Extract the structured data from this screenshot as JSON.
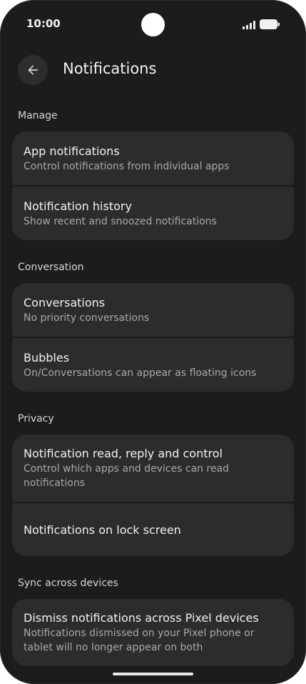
{
  "status_bar": {
    "time": "10:00",
    "icons": [
      "front-camera-icon",
      "signal-icon",
      "battery-icon"
    ]
  },
  "app_bar": {
    "back_icon": "arrow-back-icon",
    "title": "Notifications"
  },
  "sections": {
    "manage": {
      "header": "Manage",
      "items": [
        {
          "title": "App notifications",
          "summary": "Control notifications from individual apps"
        },
        {
          "title": "Notification history",
          "summary": "Show recent and snoozed notifications"
        }
      ]
    },
    "conversation": {
      "header": "Conversation",
      "items": [
        {
          "title": "Conversations",
          "summary": "No priority conversations"
        },
        {
          "title": "Bubbles",
          "summary": "On/Conversations can appear as floating icons"
        }
      ]
    },
    "privacy": {
      "header": "Privacy",
      "items": [
        {
          "title": "Notification read, reply and control",
          "summary": "Control which apps and devices can read notifications"
        },
        {
          "title": "Notifications on lock screen"
        }
      ]
    },
    "sync": {
      "header": "Sync across devices",
      "items": [
        {
          "title": "Dismiss notifications across Pixel devices",
          "summary": "Notifications dismissed on your Pixel phone or tablet will no longer appear on both"
        }
      ]
    }
  },
  "colors": {
    "background": "#1c1c1c",
    "card": "#2c2c2c",
    "primary_text": "#f2f2f2",
    "secondary_text": "#a8a8a8"
  }
}
